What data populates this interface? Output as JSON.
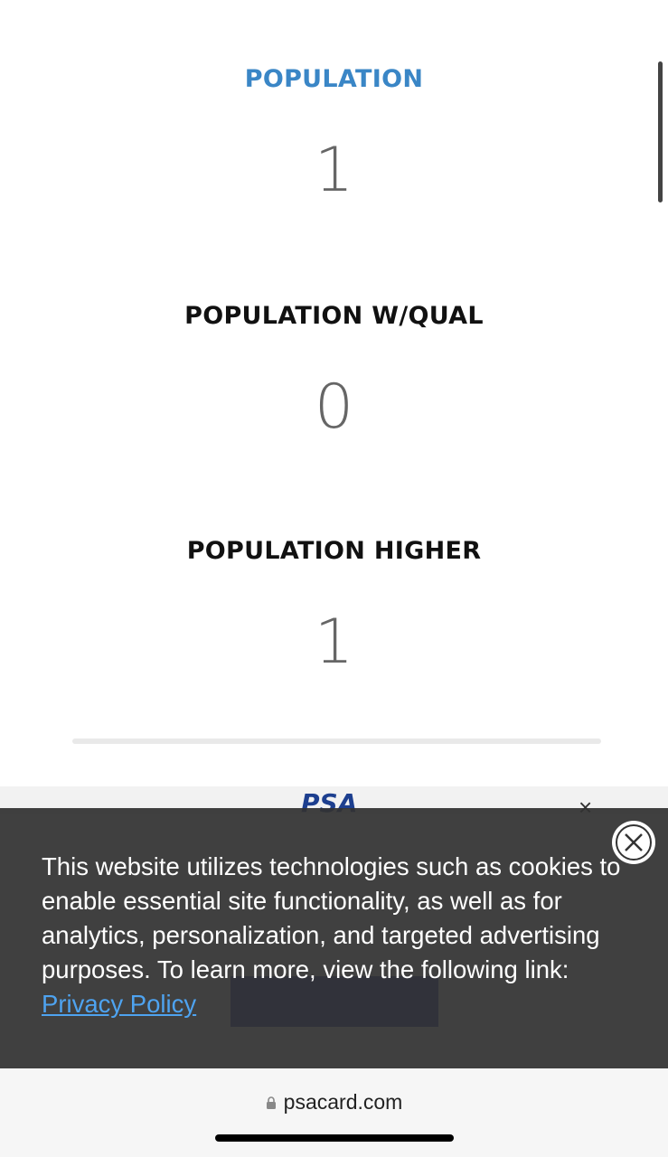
{
  "stats": [
    {
      "label": "POPULATION",
      "value": "1"
    },
    {
      "label": "POPULATION W/QUAL",
      "value": "0"
    },
    {
      "label": "POPULATION HIGHER",
      "value": "1"
    }
  ],
  "ad": {
    "logo": "PSA",
    "close_icon": "×"
  },
  "cookie_banner": {
    "text": "This website utilizes technologies such as cookies to enable essential site functionality, as well as for analytics, personalization, and targeted advertising purposes. To learn more, view the following link: ",
    "link_text": "Privacy Policy",
    "close_icon": "close-circle-icon"
  },
  "browser": {
    "url": "psacard.com",
    "lock_icon": "lock-icon"
  },
  "colors": {
    "accent_label": "#3a86c6",
    "banner_bg": "#323232",
    "link": "#4ea3f0"
  }
}
